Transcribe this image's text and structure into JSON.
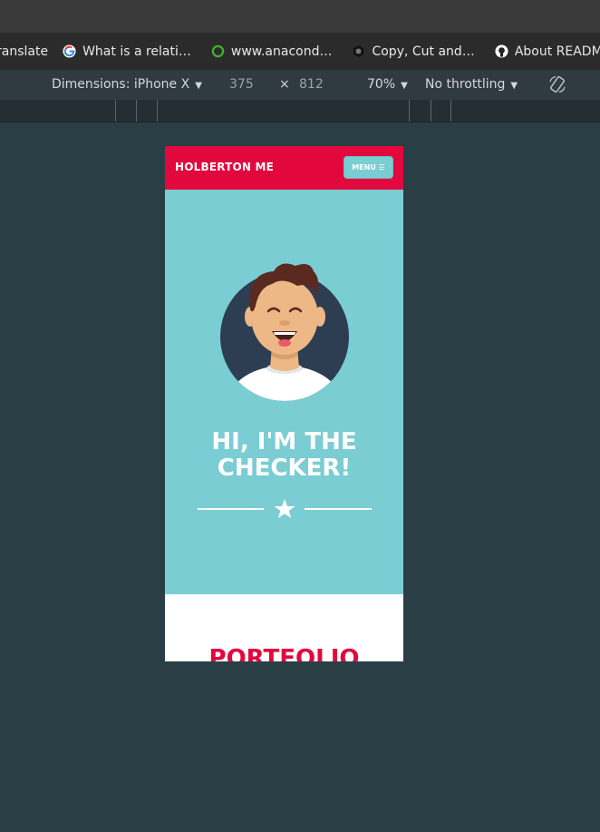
{
  "bookmarks": [
    {
      "label": "ranslate",
      "icon": "translate-icon"
    },
    {
      "label": "What is a relati…",
      "icon": "google-icon"
    },
    {
      "label": "www.anacond…",
      "icon": "anaconda-icon"
    },
    {
      "label": "Copy, Cut and…",
      "icon": "hexagon-icon"
    },
    {
      "label": "About READM…",
      "icon": "github-icon"
    }
  ],
  "devtools": {
    "dimensions": "Dimensions: iPhone X",
    "width": "375",
    "times": "×",
    "height": "812",
    "zoom": "70%",
    "throttling": "No throttling",
    "rotate_icon": "rotate-icon"
  },
  "site": {
    "brand": "HOLBERTON ME",
    "menu_label": "MENU ☰",
    "hero_title": "HI, I'M THE CHECKER!",
    "portfolio_title": "PORTFOLIO",
    "star_icon": "star-icon",
    "avatar_icon": "avatar-illustration"
  },
  "colors": {
    "brand_red": "#e2073d",
    "hero_teal": "#7acdd2",
    "backdrop": "#2a3f45"
  }
}
